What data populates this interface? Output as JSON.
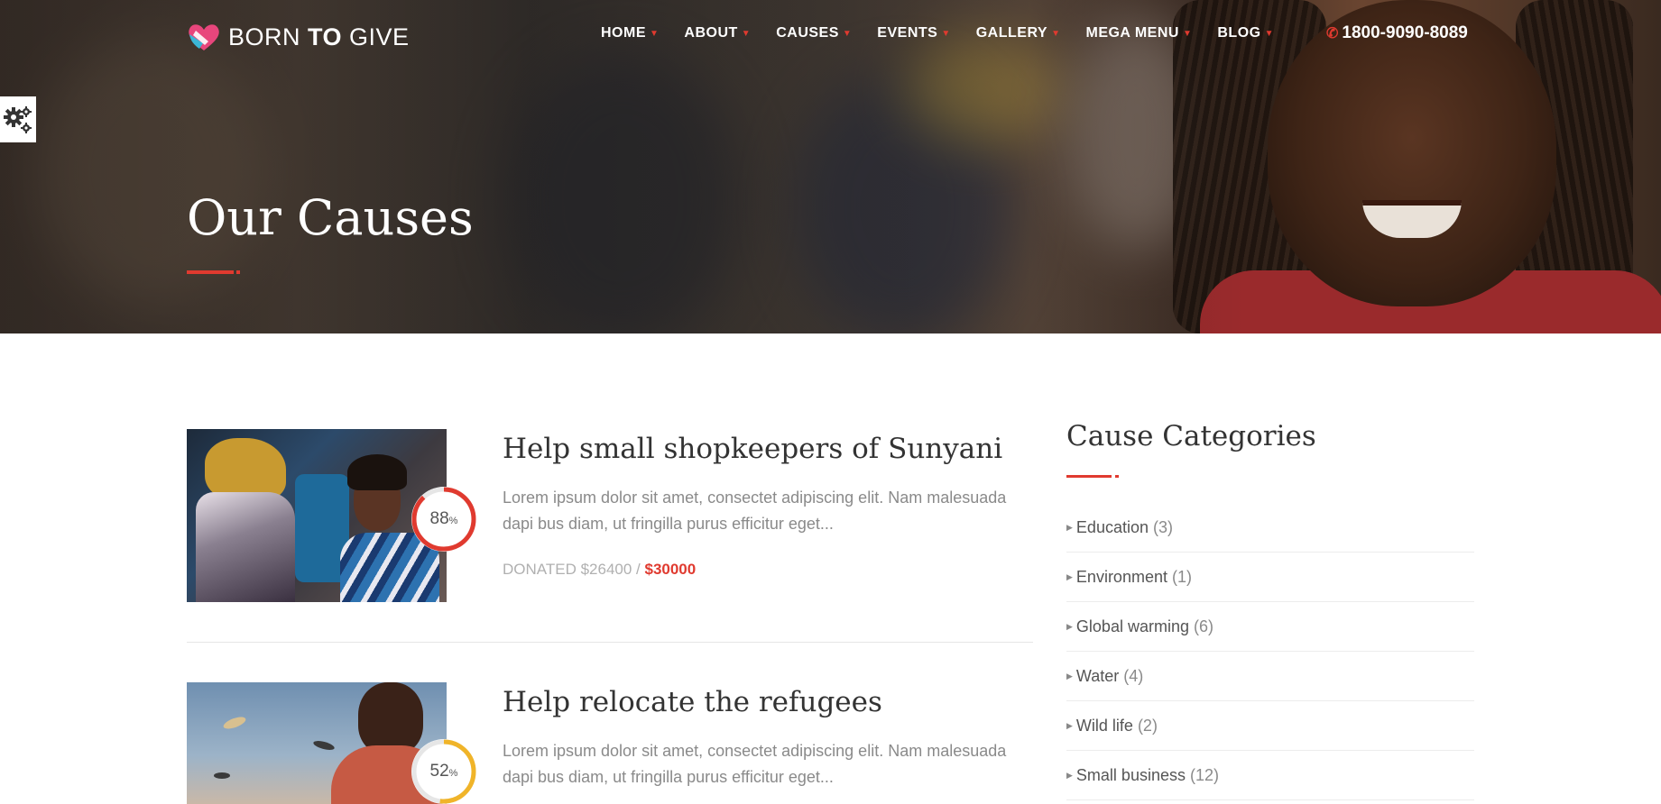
{
  "brand": {
    "name_part1": "BORN ",
    "name_part2": "TO",
    "name_part3": " GIVE"
  },
  "nav": [
    {
      "label": "HOME"
    },
    {
      "label": "ABOUT"
    },
    {
      "label": "CAUSES"
    },
    {
      "label": "EVENTS"
    },
    {
      "label": "GALLERY"
    },
    {
      "label": "MEGA MENU"
    },
    {
      "label": "BLOG"
    }
  ],
  "phone": "1800-9090-8089",
  "hero": {
    "title": "Our Causes"
  },
  "causes": [
    {
      "title": "Help small shopkeepers of Sunyani",
      "description": "Lorem ipsum dolor sit amet, consectet adipiscing elit. Nam malesuada dapi bus diam, ut fringilla purus efficitur eget...",
      "percent": 88,
      "percent_unit": "%",
      "donated_label": "DONATED $26400 / ",
      "goal": "$30000",
      "ring_color": "#e03a2f"
    },
    {
      "title": "Help relocate the refugees",
      "description": "Lorem ipsum dolor sit amet, consectet adipiscing elit. Nam malesuada dapi bus diam, ut fringilla purus efficitur eget...",
      "percent": 52,
      "percent_unit": "%",
      "ring_color": "#f0b429"
    }
  ],
  "sidebar": {
    "title": "Cause Categories",
    "categories": [
      {
        "label": "Education",
        "count": "(3)"
      },
      {
        "label": "Environment",
        "count": "(1)"
      },
      {
        "label": "Global warming",
        "count": "(6)"
      },
      {
        "label": "Water",
        "count": "(4)"
      },
      {
        "label": "Wild life",
        "count": "(2)"
      },
      {
        "label": "Small business",
        "count": "(12)"
      }
    ]
  },
  "colors": {
    "accent": "#e03a2f",
    "ring_secondary": "#f0b429"
  }
}
